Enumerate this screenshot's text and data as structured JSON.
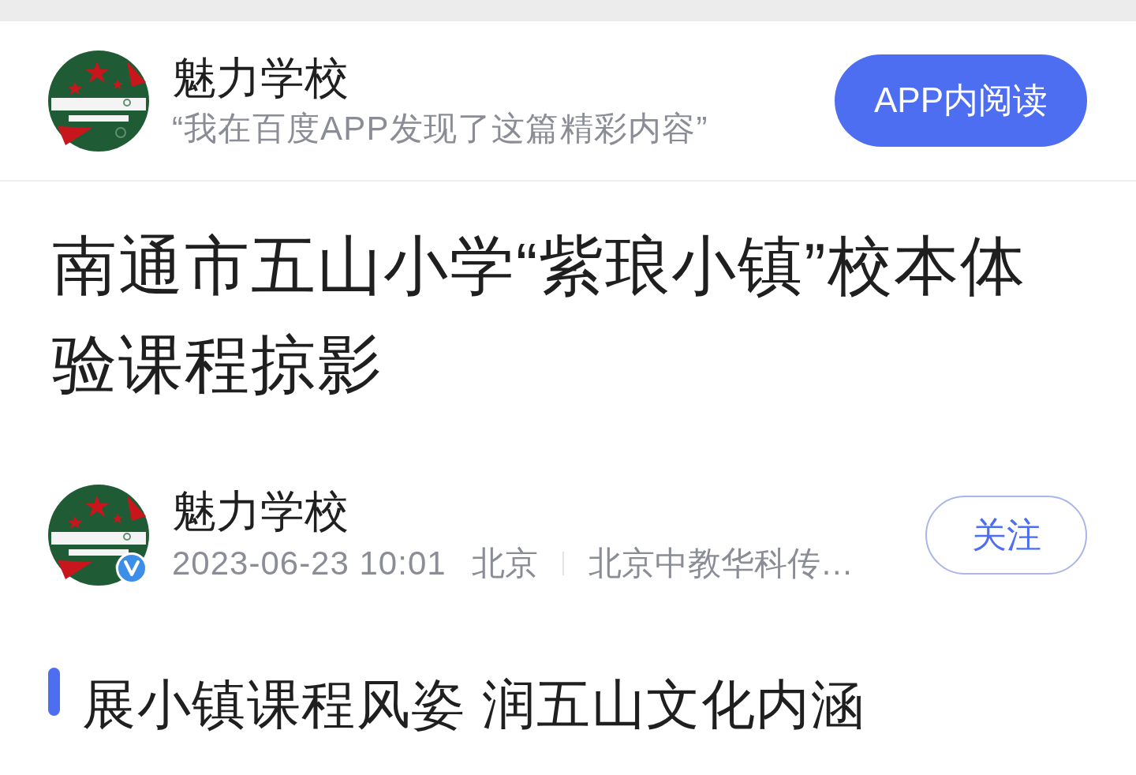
{
  "header": {
    "account_name": "魅力学校",
    "promo_text": "“我在百度APP发现了这篇精彩内容”",
    "open_button": "APP内阅读"
  },
  "article": {
    "title": "南通市五山小学“紫琅小镇”校本体验课程掠影",
    "author": {
      "name": "魅力学校",
      "verified": true,
      "date": "2023-06-23 10:01",
      "location": "北京",
      "source": "北京中教华科传…",
      "follow_button": "关注"
    },
    "sections": [
      {
        "heading": "展小镇课程风姿 润五山文化内涵"
      }
    ]
  }
}
